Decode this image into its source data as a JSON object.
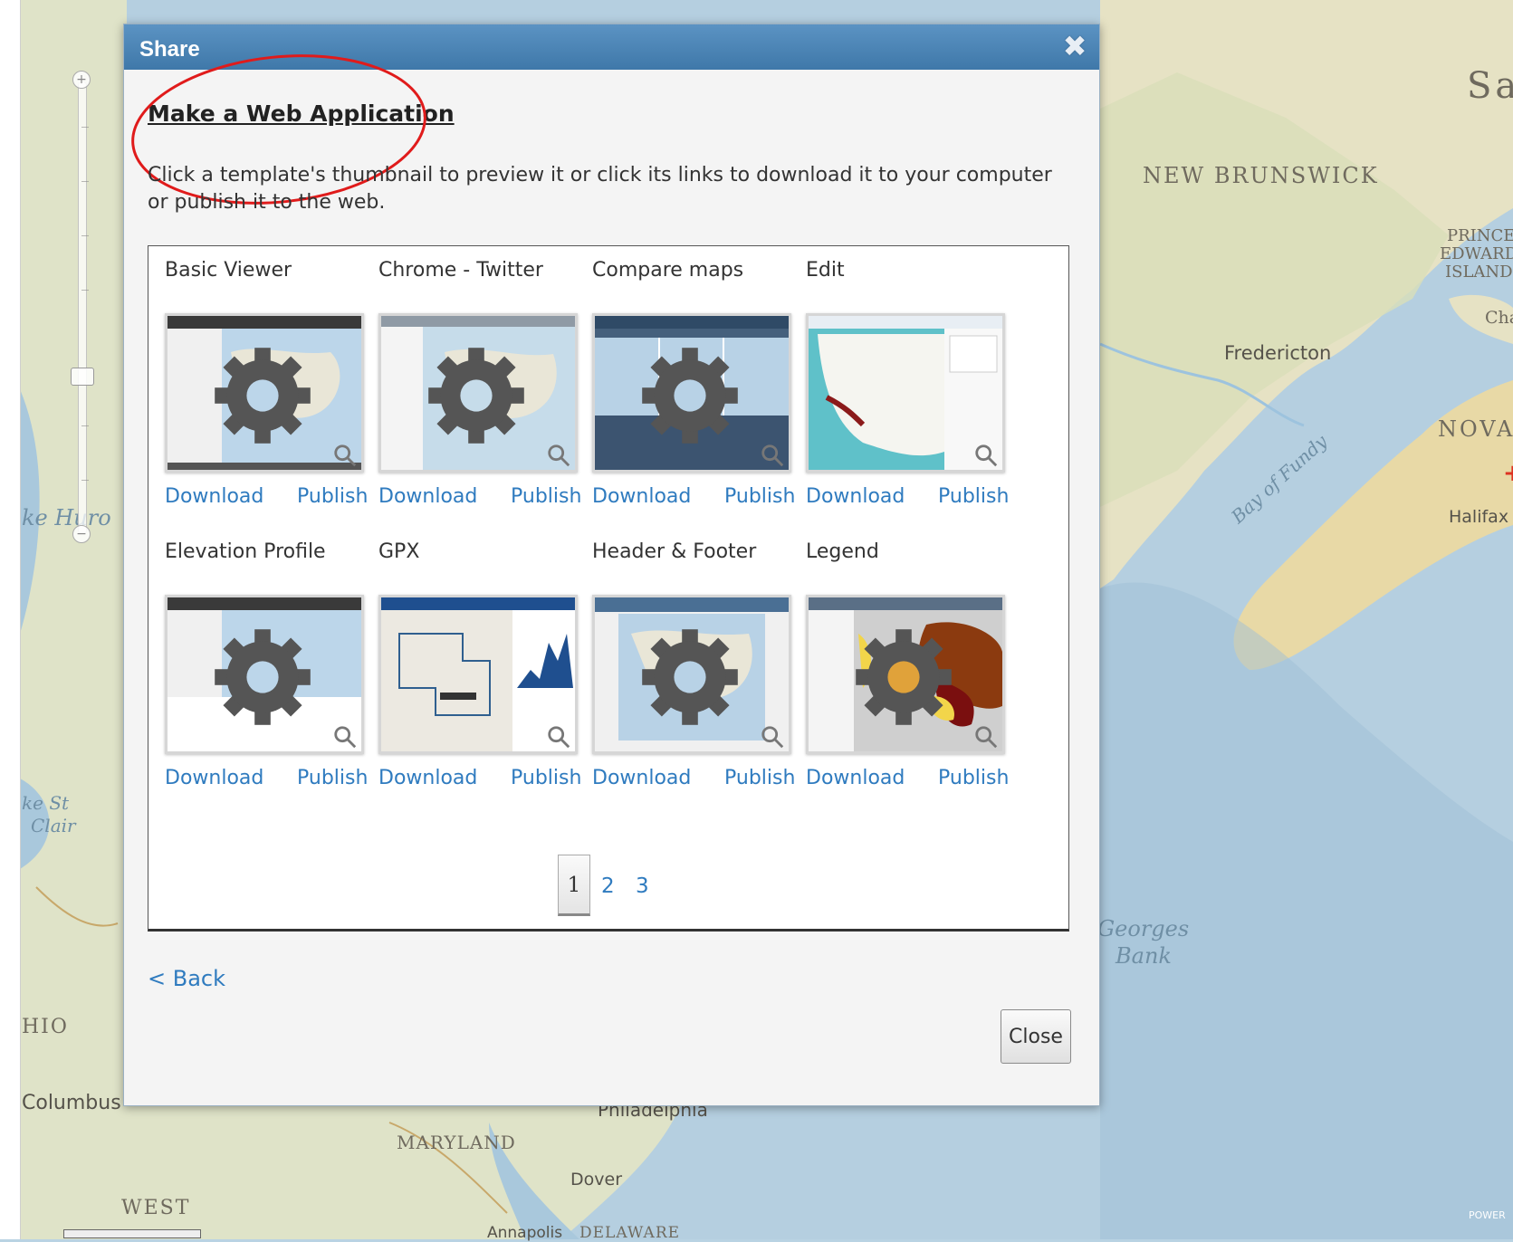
{
  "map": {
    "labels": {
      "new_brunswick": "NEW BRUNSWICK",
      "prince": "PRINCE",
      "edward": "EDWARD",
      "island": "ISLAND",
      "fredericton": "Fredericton",
      "nova": "NOVA",
      "halifax": "Halifax",
      "bay_of_fundy": "Bay of Fundy",
      "georges": "Georges",
      "bank": "Bank",
      "cha": "Cha",
      "sa": "Sa",
      "lake_huron": "ke Huro",
      "lake_st": "ke St",
      "clair": "Clair",
      "ohio": "HIO",
      "columbus": "Columbus",
      "maryland": "MARYLAND",
      "dover": "Dover",
      "west": "WEST",
      "annapolis": "Annapolis",
      "delaware": "DELAWARE",
      "philadelphia": "Philadelphia",
      "powered": "POWER"
    }
  },
  "dialog": {
    "title": "Share",
    "close_icon": "close-x-icon",
    "heading": "Make a Web Application",
    "instructions": "Click a template's thumbnail to preview it or click its links to download it to your computer or publish it to the web.",
    "templates": [
      {
        "name": "Basic Viewer",
        "download": "Download",
        "publish": "Publish"
      },
      {
        "name": "Chrome - Twitter",
        "download": "Download",
        "publish": "Publish"
      },
      {
        "name": "Compare maps",
        "download": "Download",
        "publish": "Publish"
      },
      {
        "name": "Edit",
        "download": "Download",
        "publish": "Publish"
      },
      {
        "name": "Elevation Profile",
        "download": "Download",
        "publish": "Publish"
      },
      {
        "name": "GPX",
        "download": "Download",
        "publish": "Publish"
      },
      {
        "name": "Header & Footer",
        "download": "Download",
        "publish": "Publish"
      },
      {
        "name": "Legend",
        "download": "Download",
        "publish": "Publish"
      }
    ],
    "pagination": {
      "pages": [
        "1",
        "2",
        "3"
      ],
      "current": "1"
    },
    "back_label": "< Back",
    "close_label": "Close"
  },
  "colors": {
    "titlebar": "#4a86b8",
    "link": "#2f7bbf",
    "annotation": "#e01b1b"
  }
}
